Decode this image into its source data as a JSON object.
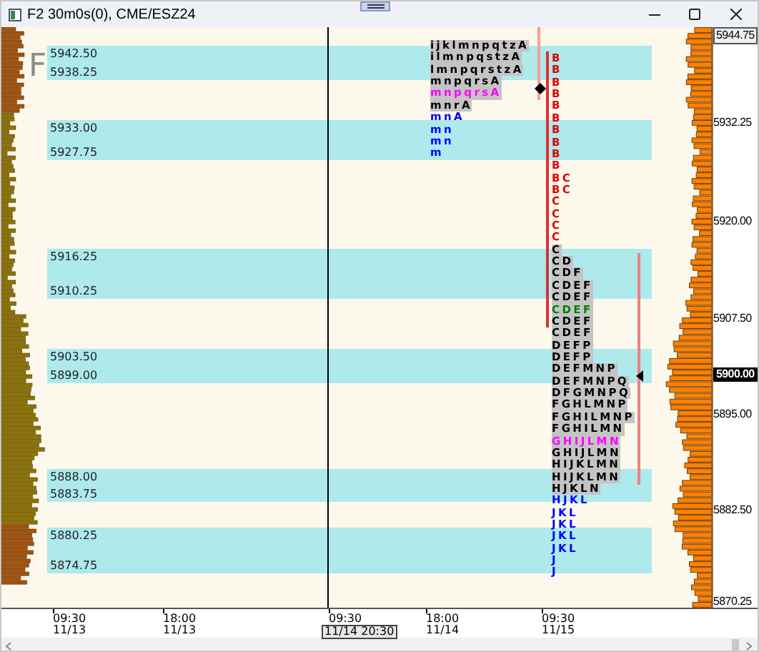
{
  "window": {
    "title": "F2 30m0s(0), CME/ESZ24"
  },
  "chart": {
    "watermark": "F",
    "bands": [
      {
        "high": "5942.50",
        "low": "5938.25"
      },
      {
        "high": "5933.00",
        "low": "5927.75"
      },
      {
        "high": "5916.25",
        "low": "5910.25"
      },
      {
        "high": "5903.50",
        "low": "5899.00"
      },
      {
        "high": "5888.00",
        "low": "5883.75"
      },
      {
        "high": "5880.25",
        "low": "5874.75"
      }
    ],
    "profiles": [
      {
        "rows": [
          {
            "letters": "ijklmnpqtzA",
            "kind": "plain"
          },
          {
            "letters": "ilmnpqstzA",
            "kind": "plain"
          },
          {
            "letters": "lmnpqrstzA",
            "kind": "plain"
          },
          {
            "letters": "mnpqrsA",
            "kind": "plain"
          },
          {
            "letters": "mnpqrsA",
            "kind": "poc"
          },
          {
            "letters": "mnrA",
            "kind": "plain"
          },
          {
            "letters": "mnA",
            "kind": "single"
          },
          {
            "letters": "mn",
            "kind": "single"
          },
          {
            "letters": "mn",
            "kind": "single"
          },
          {
            "letters": "m",
            "kind": "single"
          }
        ]
      },
      {
        "rows": [
          {
            "letters": "B",
            "kind": "red"
          },
          {
            "letters": "B",
            "kind": "red"
          },
          {
            "letters": "B",
            "kind": "red"
          },
          {
            "letters": "B",
            "kind": "red"
          },
          {
            "letters": "B",
            "kind": "red"
          },
          {
            "letters": "B",
            "kind": "red"
          },
          {
            "letters": "B",
            "kind": "red"
          },
          {
            "letters": "B",
            "kind": "red"
          },
          {
            "letters": "B",
            "kind": "red"
          },
          {
            "letters": "B",
            "kind": "red"
          },
          {
            "letters": "BC",
            "kind": "red"
          },
          {
            "letters": "BC",
            "kind": "red"
          },
          {
            "letters": "C",
            "kind": "red"
          },
          {
            "letters": "C",
            "kind": "red"
          },
          {
            "letters": "C",
            "kind": "red"
          },
          {
            "letters": "C",
            "kind": "red"
          },
          {
            "letters": "C",
            "kind": "plain"
          },
          {
            "letters": "CD",
            "kind": "plain"
          },
          {
            "letters": "CDF",
            "kind": "plain"
          },
          {
            "letters": "CDEF",
            "kind": "plain"
          },
          {
            "letters": "CDEF",
            "kind": "plain"
          },
          {
            "letters": "CDEF",
            "kind": "green"
          },
          {
            "letters": "CDEF",
            "kind": "plain"
          },
          {
            "letters": "CDEF",
            "kind": "plain"
          },
          {
            "letters": "DEFP",
            "kind": "plain"
          },
          {
            "letters": "DEFP",
            "kind": "plain"
          },
          {
            "letters": "DEFMNP",
            "kind": "plain"
          },
          {
            "letters": "DEFMNPQ",
            "kind": "plain"
          },
          {
            "letters": "DFGMNPQ",
            "kind": "plain"
          },
          {
            "letters": "FGHLMNP",
            "kind": "plain"
          },
          {
            "letters": "FGHILMNP",
            "kind": "plain"
          },
          {
            "letters": "FGHILMN",
            "kind": "plain"
          },
          {
            "letters": "GHIJLMN",
            "kind": "poc"
          },
          {
            "letters": "GHIJLMN",
            "kind": "plain"
          },
          {
            "letters": "HIJKLMN",
            "kind": "plain"
          },
          {
            "letters": "HIJKLMN",
            "kind": "plain"
          },
          {
            "letters": "HJKLN",
            "kind": "plain"
          },
          {
            "letters": "HJKL",
            "kind": "single"
          },
          {
            "letters": "JKL",
            "kind": "single"
          },
          {
            "letters": "JKL",
            "kind": "single"
          },
          {
            "letters": "JKL",
            "kind": "single"
          },
          {
            "letters": "JKL",
            "kind": "single"
          },
          {
            "letters": "J",
            "kind": "single"
          },
          {
            "letters": "J",
            "kind": "single"
          }
        ]
      }
    ],
    "price_axis": {
      "labels": [
        {
          "text": "5944.75",
          "kind": "boxed"
        },
        {
          "text": "5932.25",
          "kind": "plain"
        },
        {
          "text": "5920.00",
          "kind": "plain"
        },
        {
          "text": "5907.50",
          "kind": "plain"
        },
        {
          "text": "5900.00",
          "kind": "current"
        },
        {
          "text": "5895.00",
          "kind": "plain"
        },
        {
          "text": "5882.50",
          "kind": "plain"
        },
        {
          "text": "5870.25",
          "kind": "plain"
        }
      ]
    },
    "time_axis": {
      "labels": [
        {
          "time": "09:30",
          "date": "11/13"
        },
        {
          "time": "18:00",
          "date": "11/13"
        },
        {
          "time": "09:30"
        },
        {
          "time": "18:00",
          "date": "11/14"
        },
        {
          "time": "09:30",
          "date": "11/15"
        }
      ],
      "cursor_label": "11/14 20:30"
    }
  }
}
